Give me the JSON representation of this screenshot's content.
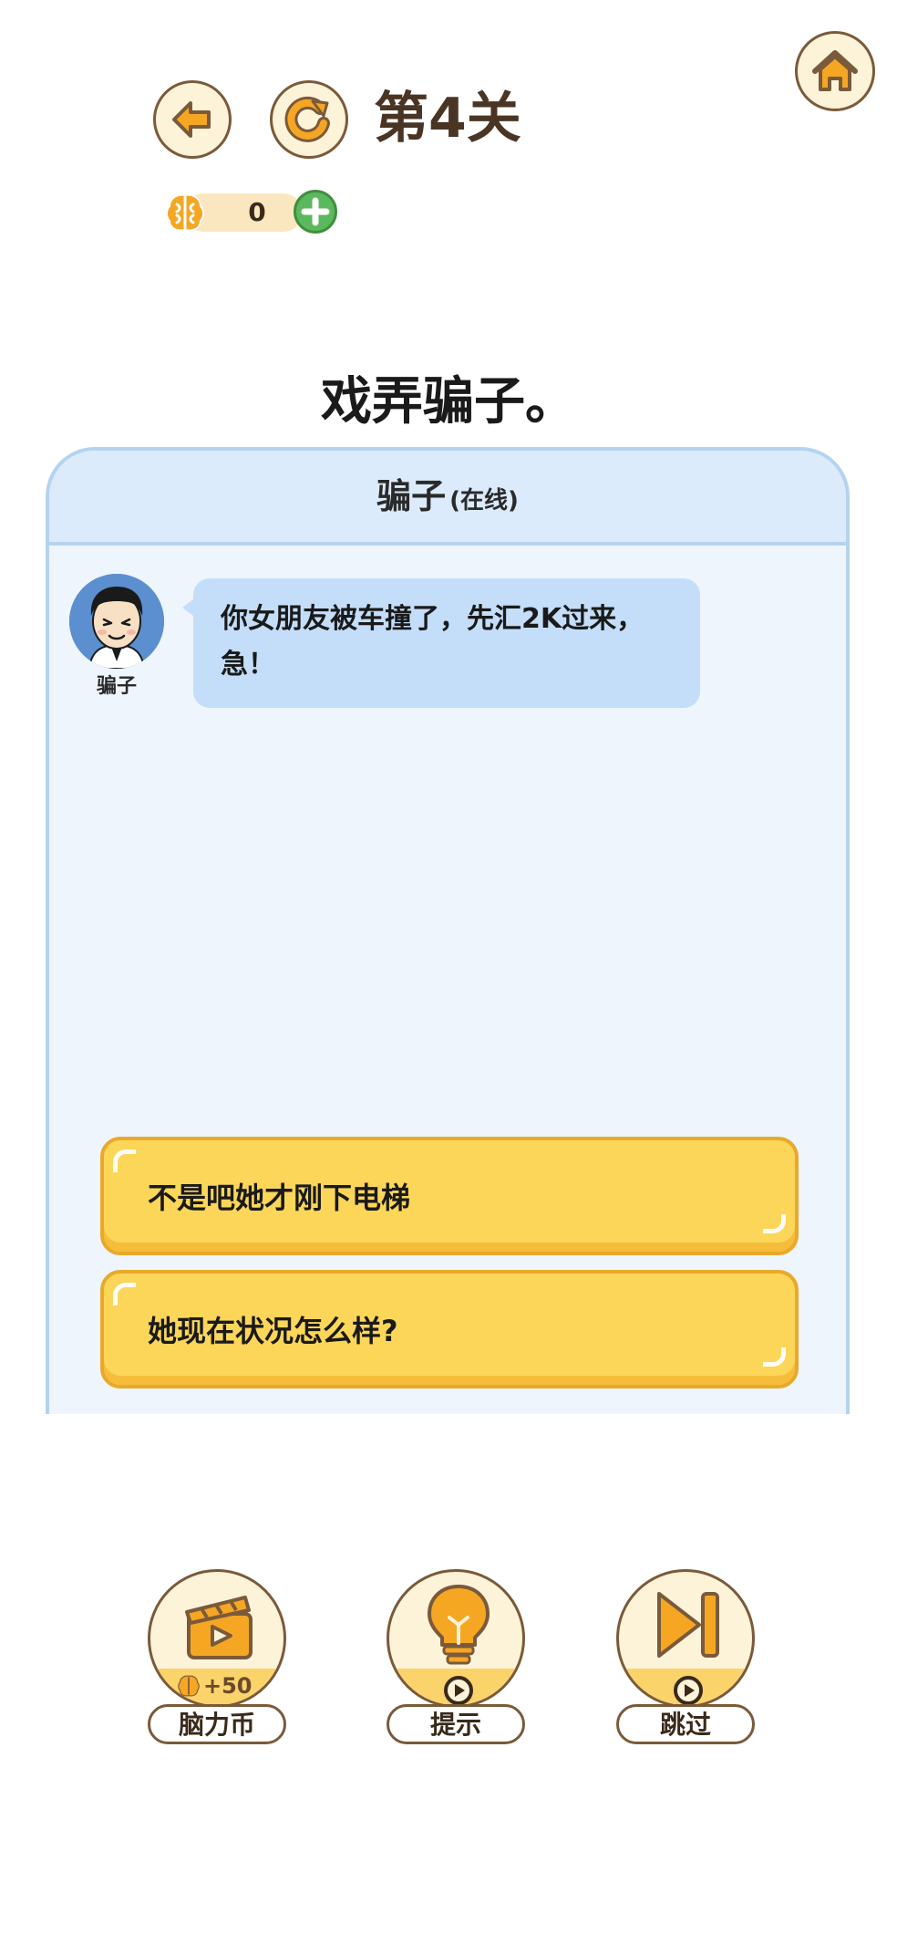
{
  "header": {
    "level_title": "第4关",
    "home_icon": "home-icon",
    "back_icon": "arrow-left-icon",
    "restart_icon": "restart-icon"
  },
  "currency": {
    "icon": "brain-icon",
    "value": "0",
    "add_icon": "plus-icon"
  },
  "question": "戏弄骗子。",
  "chat": {
    "contact_name": "骗子",
    "contact_status": "(在线)",
    "messages": [
      {
        "sender": "骗子",
        "avatar": "scammer-avatar",
        "text": "你女朋友被车撞了，先汇2K过来，急！"
      }
    ]
  },
  "options": [
    {
      "label": "不是吧她才刚下电梯"
    },
    {
      "label": "她现在状况怎么样?"
    }
  ],
  "actions": [
    {
      "label": "脑力币",
      "icon": "video-clapper-icon",
      "reward": "+50",
      "reward_icon": "brain-icon"
    },
    {
      "label": "提示",
      "icon": "lightbulb-icon",
      "badge_icon": "play-icon"
    },
    {
      "label": "跳过",
      "icon": "skip-forward-icon",
      "badge_icon": "play-icon"
    }
  ],
  "colors": {
    "accent_yellow": "#fcd659",
    "accent_orange": "#f5a623",
    "chat_bg": "#eef5fd",
    "bubble_bg": "#c4defa",
    "brown_outline": "#7a5a3a"
  }
}
